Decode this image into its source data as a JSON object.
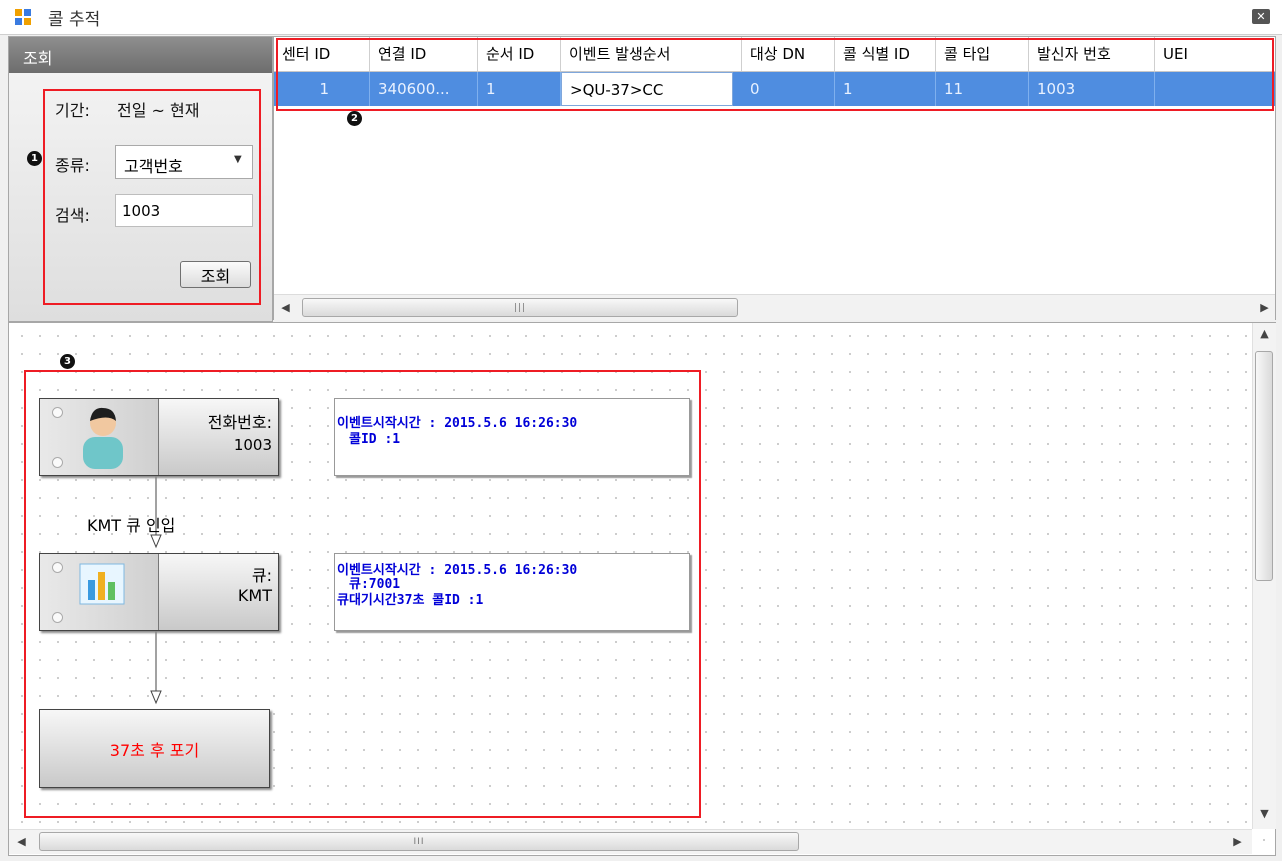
{
  "window": {
    "title": "콜 추적",
    "close_label": "✕"
  },
  "query_panel": {
    "header": "조회",
    "period_label": "기간:",
    "period_value": "전일 ~ 현재",
    "type_label": "종류:",
    "type_value": "고객번호",
    "search_label": "검색:",
    "search_value": "1003",
    "query_button": "조회",
    "badge": "1"
  },
  "grid": {
    "badge": "2",
    "columns": [
      "센터 ID",
      "연결 ID",
      "순서 ID",
      "이벤트 발생순서",
      "대상 DN",
      "콜 식별 ID",
      "콜 타입",
      "발신자 번호",
      "UEI"
    ],
    "row": [
      "1",
      "340600...",
      "1",
      ">QU-37>CC",
      "0",
      "1",
      "11",
      "1003",
      ""
    ],
    "scroll_grip": "|||"
  },
  "diagram": {
    "badge": "3",
    "node_phone": {
      "label": "전화번호:",
      "value": "1003"
    },
    "edge1_label": "KMT 큐 인입",
    "node_queue": {
      "label": "큐:",
      "value": "KMT"
    },
    "node_end": {
      "label": "37초 후 포기"
    },
    "info1": {
      "line1": "이벤트시작시간 : 2015.5.6 16:26:30",
      "line2": "콜ID :1"
    },
    "info2": {
      "line1": "이벤트시작시간 : 2015.5.6 16:26:30",
      "line2": "큐:7001",
      "line3": "큐대기시간37초 콜ID :1"
    },
    "scroll_grip": "III",
    "colors": {
      "highlight": "#ee1c24",
      "info_text": "#0000d8",
      "end_text": "#ff0000"
    }
  }
}
